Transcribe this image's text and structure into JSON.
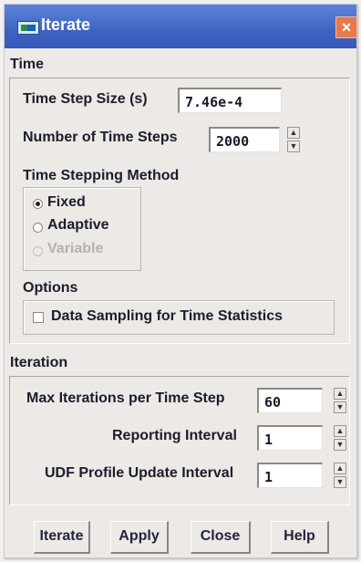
{
  "window": {
    "title": "Iterate",
    "close_label": "×"
  },
  "time": {
    "section_label": "Time",
    "step_size_label": "Time Step Size (s)",
    "step_size_value": "7.46e-4",
    "num_steps_label": "Number of Time Steps",
    "num_steps_value": "2000",
    "method_label": "Time Stepping Method",
    "methods": [
      {
        "label": "Fixed",
        "selected": true,
        "enabled": true
      },
      {
        "label": "Adaptive",
        "selected": false,
        "enabled": true
      },
      {
        "label": "Variable",
        "selected": false,
        "enabled": false
      }
    ],
    "options_label": "Options",
    "data_sampling_label": "Data Sampling for Time Statistics",
    "data_sampling_checked": false
  },
  "iteration": {
    "section_label": "Iteration",
    "max_iter_label": "Max Iterations per Time Step",
    "max_iter_value": "60",
    "reporting_label": "Reporting Interval",
    "reporting_value": "1",
    "udf_label": "UDF Profile Update Interval",
    "udf_value": "1"
  },
  "buttons": {
    "iterate": "Iterate",
    "apply": "Apply",
    "close": "Close",
    "help": "Help"
  },
  "colors": {
    "titlebar": "#3f63c2",
    "close_button": "#e57a4d"
  }
}
